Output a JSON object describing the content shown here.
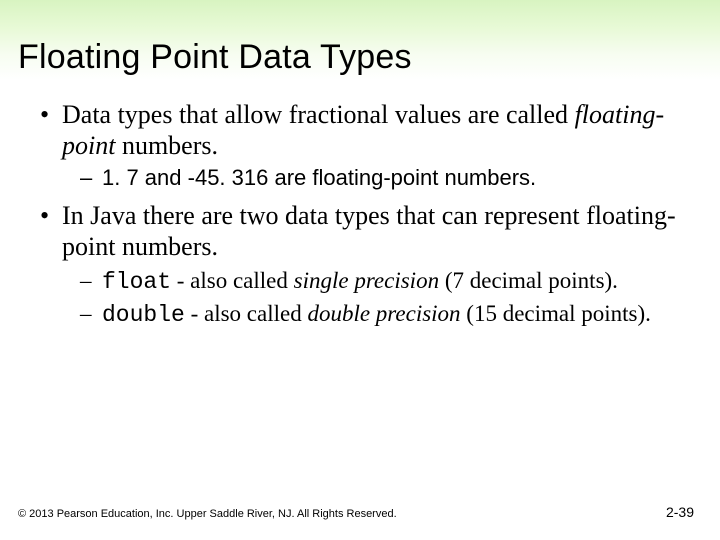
{
  "title": "Floating Point Data Types",
  "bullets": {
    "b1_pre": "Data types that allow fractional values are called ",
    "b1_ital": "floating-point",
    "b1_post": " numbers.",
    "b1a": "1. 7 and -45. 316 are floating-point numbers.",
    "b2": "In Java there are two data types that can represent floating-point numbers.",
    "b2a_mono": "float",
    "b2a_mid": " - also called ",
    "b2a_ital": "single precision",
    "b2a_post": " (7 decimal points).",
    "b2b_mono": "double",
    "b2b_mid": " - also called ",
    "b2b_ital": "double precision",
    "b2b_post": " (15 decimal points)."
  },
  "footer": {
    "copyright": "© 2013 Pearson Education, Inc. Upper Saddle River, NJ. All Rights Reserved.",
    "pagenum": "2-39"
  },
  "glyphs": {
    "bullet": "•",
    "dash": "–"
  }
}
